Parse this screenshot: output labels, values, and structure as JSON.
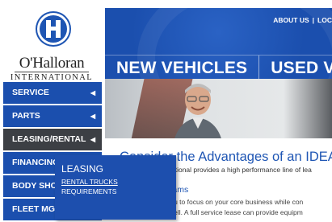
{
  "logo": {
    "name": "O'Halloran",
    "subtitle": "INTERNATIONAL"
  },
  "header": {
    "top_links": [
      "ABOUT US",
      "LOC"
    ],
    "top_links_separator": "|",
    "tabs": [
      "NEW VEHICLES",
      "USED VEH"
    ]
  },
  "sidebar": {
    "items": [
      {
        "label": "SERVICE"
      },
      {
        "label": "PARTS"
      },
      {
        "label": "LEASING/RENTAL"
      },
      {
        "label": "FINANCING"
      },
      {
        "label": "BODY SHOP"
      },
      {
        "label": "FLEET MGMT"
      }
    ],
    "chevron_icon": "chevron-left-icon"
  },
  "flyout": {
    "title": "LEASING",
    "links": [
      "RENTAL TRUCKS",
      "REQUIREMENTS"
    ]
  },
  "content": {
    "title": "Consider the Advantages of an IDEAL",
    "subtitle": "O'Halloran International provides a high performance line of lea",
    "section_heading": "Leasing Programs",
    "paragraph_line1": "Leasing allows you to focus on your core business while con",
    "paragraph_line2": "sheet issues as well. A full service lease can provide equipm"
  },
  "colors": {
    "brand_blue": "#1b4fae",
    "active_item": "#3c3f44",
    "heading_blue": "#1f56b4"
  }
}
